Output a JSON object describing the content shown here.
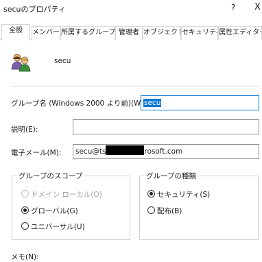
{
  "window": {
    "title": "secuのプロパティ",
    "help": "?",
    "close": "X"
  },
  "tabs": [
    {
      "label": "全般",
      "active": true
    },
    {
      "label": "メンバー",
      "active": false
    },
    {
      "label": "所属するグループ",
      "active": false
    },
    {
      "label": "管理者",
      "active": false
    },
    {
      "label": "オブジェクト",
      "active": false
    },
    {
      "label": "セキュリティ",
      "active": false
    },
    {
      "label": "属性エディター",
      "active": false
    }
  ],
  "header": {
    "icon": "group-users-icon",
    "name": "secu"
  },
  "form": {
    "group_name_label": "グループ名 (Windows 2000 より前)(W):",
    "group_name_value": "secu",
    "description_label": "説明(E):",
    "description_value": "",
    "email_label": "電子メール(M):",
    "email_value_prefix": "secu@ts",
    "email_value_suffix": "rosoft.com",
    "memo_label": "メモ(N):"
  },
  "scope": {
    "legend": "グループのスコープ",
    "options": [
      {
        "label": "ドメイン ローカル(O)",
        "selected": false,
        "disabled": true
      },
      {
        "label": "グローバル(G)",
        "selected": true,
        "disabled": false
      },
      {
        "label": "ユニバーサル(U)",
        "selected": false,
        "disabled": false
      }
    ]
  },
  "type": {
    "legend": "グループの種類",
    "options": [
      {
        "label": "セキュリティ(S)",
        "selected": true,
        "disabled": false
      },
      {
        "label": "配布(B)",
        "selected": false,
        "disabled": false
      }
    ]
  },
  "colors": {
    "accent": "#0a78d4",
    "text": "#1b1b1b",
    "disabled_text": "#a0a0a0"
  }
}
